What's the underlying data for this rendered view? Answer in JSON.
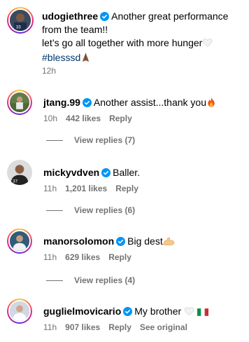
{
  "caption": {
    "username": "udogiethree",
    "text_line1": "Another great performance from the team!!",
    "text_line2": "let’s go all together with more hunger",
    "hashtag": "#blesssd",
    "time": "12h"
  },
  "comments": [
    {
      "username": "jtang.99",
      "text": "Another assist...thank you",
      "time": "10h",
      "likes": "442 likes",
      "reply": "Reply",
      "view_replies": "View replies (7)"
    },
    {
      "username": "mickyvdven",
      "text": "Baller.",
      "time": "11h",
      "likes": "1,201 likes",
      "reply": "Reply",
      "view_replies": "View replies (6)"
    },
    {
      "username": "manorsolomon",
      "text": "Big dest",
      "time": "11h",
      "likes": "629 likes",
      "reply": "Reply",
      "view_replies": "View replies (4)"
    },
    {
      "username": "guglielmovicario",
      "text": "My brother",
      "time": "11h",
      "likes": "907 likes",
      "reply": "Reply",
      "see_original": "See original"
    }
  ],
  "colors": {
    "verified": "#0095f6",
    "secondary_text": "#737373",
    "hashtag": "#00376b"
  },
  "icons": [
    "verified-badge-icon",
    "white-heart-emoji",
    "folded-hands-emoji",
    "fire-emoji",
    "flexed-biceps-emoji",
    "italy-flag-emoji"
  ]
}
